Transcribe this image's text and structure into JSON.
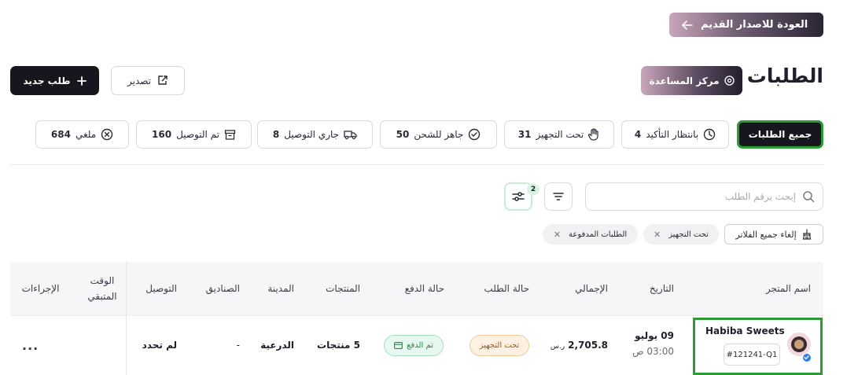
{
  "back_button": {
    "label": "العودة للاصدار القديم"
  },
  "header": {
    "title": "الطلبات",
    "help_label": "مركز المساعدة",
    "export_label": "تصدير",
    "new_order_label": "طلب جديد"
  },
  "tabs": [
    {
      "label": "جميع الطلبات",
      "count": "",
      "icon": "none",
      "active": true
    },
    {
      "label": "بانتظار التأكيد",
      "count": "4",
      "icon": "clock-icon",
      "active": false
    },
    {
      "label": "تحت التجهيز",
      "count": "31",
      "icon": "hand-icon",
      "active": false
    },
    {
      "label": "جاهز للشحن",
      "count": "50",
      "icon": "check-circle-icon",
      "active": false
    },
    {
      "label": "جاري التوصيل",
      "count": "8",
      "icon": "truck-icon",
      "active": false
    },
    {
      "label": "تم التوصيل",
      "count": "160",
      "icon": "box-icon",
      "active": false
    },
    {
      "label": "ملغي",
      "count": "684",
      "icon": "x-circle-icon",
      "active": false
    }
  ],
  "search": {
    "placeholder": "إبحث برقم الطلب"
  },
  "filter_badge": "2",
  "filters": {
    "clear_label": "إلغاء جميع الفلاتر",
    "chips": [
      "تحت التجهيز",
      "الطلبات المدفوعة"
    ]
  },
  "table": {
    "headers": {
      "store": "اسم المتجر",
      "date": "التاريخ",
      "total": "الإجمالي",
      "order_status": "حالة الطلب",
      "payment_status": "حالة الدفع",
      "products": "المنتجات",
      "city": "المدينة",
      "boxes": "الصناديق",
      "delivery": "التوصيل",
      "remaining_line1": "الوقت",
      "remaining_line2": "المتبقي",
      "actions": "الإجراءات"
    },
    "rows": [
      {
        "store_name": "Habiba Sweets",
        "order_id": "#121241-Q1",
        "date": "09 يوليو",
        "time": "03:00 ص",
        "total": "2,705.8",
        "currency": "ر.س",
        "order_status": "تحت التجهيز",
        "payment_status": "تم الدفع",
        "products": "5 منتجات",
        "city": "الدرعية",
        "boxes": "-",
        "delivery": "لم تحدد",
        "actions": "..."
      }
    ]
  },
  "colors": {
    "primary_dark": "#16161e",
    "highlight_green": "#2d9b35",
    "paid_green": "#1f8a4b",
    "processing_orange": "#9a5a14"
  }
}
